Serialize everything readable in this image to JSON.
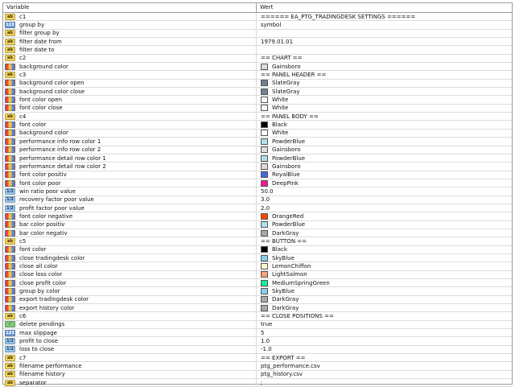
{
  "header": {
    "variable": "Variable",
    "value": "Wert"
  },
  "rows": [
    {
      "icon": "str",
      "name": "c1",
      "value": "====== EA_PTG_TRADINGDESK SETTINGS ======"
    },
    {
      "icon": "int",
      "name": "group by",
      "value": "symbol"
    },
    {
      "icon": "str",
      "name": "filter group by",
      "value": ""
    },
    {
      "icon": "str",
      "name": "filter date from",
      "value": "1979.01.01"
    },
    {
      "icon": "str",
      "name": "filter date to",
      "value": ""
    },
    {
      "icon": "str",
      "name": "c2",
      "value": "== CHART =="
    },
    {
      "icon": "color",
      "name": "background color",
      "value": "Gainsboro",
      "swatch": "#dcdcdc"
    },
    {
      "icon": "str",
      "name": "c3",
      "value": "== PANEL HEADER =="
    },
    {
      "icon": "color",
      "name": "background color open",
      "value": "SlateGray",
      "swatch": "#708090"
    },
    {
      "icon": "color",
      "name": "background color close",
      "value": "SlateGray",
      "swatch": "#708090"
    },
    {
      "icon": "color",
      "name": "font color open",
      "value": "White",
      "swatch": "#ffffff"
    },
    {
      "icon": "color",
      "name": "font color close",
      "value": "White",
      "swatch": "#ffffff"
    },
    {
      "icon": "str",
      "name": "c4",
      "value": "== PANEL BODY =="
    },
    {
      "icon": "color",
      "name": "font color",
      "value": "Black",
      "swatch": "#000000"
    },
    {
      "icon": "color",
      "name": "background color",
      "value": "White",
      "swatch": "#ffffff"
    },
    {
      "icon": "color",
      "name": "performance info row color 1",
      "value": "PowderBlue",
      "swatch": "#b0e0e6"
    },
    {
      "icon": "color",
      "name": "performance info row color 2",
      "value": "Gainsboro",
      "swatch": "#dcdcdc"
    },
    {
      "icon": "color",
      "name": "performance detail row color 1",
      "value": "PowderBlue",
      "swatch": "#b0e0e6"
    },
    {
      "icon": "color",
      "name": "performance detail row color 2",
      "value": "Gainsboro",
      "swatch": "#dcdcdc"
    },
    {
      "icon": "color",
      "name": "font color positiv",
      "value": "RoyalBlue",
      "swatch": "#4169e1"
    },
    {
      "icon": "color",
      "name": "font color poor",
      "value": "DeepPink",
      "swatch": "#ff1493"
    },
    {
      "icon": "dbl",
      "name": "win ratio poor value",
      "value": "50.0"
    },
    {
      "icon": "dbl",
      "name": "recovery factor poor value",
      "value": "3.0"
    },
    {
      "icon": "dbl",
      "name": "profit factor poor value",
      "value": "2.0"
    },
    {
      "icon": "color",
      "name": "font color negative",
      "value": "OrangeRed",
      "swatch": "#ff4500"
    },
    {
      "icon": "color",
      "name": "bar color positiv",
      "value": "PowderBlue",
      "swatch": "#b0e0e6"
    },
    {
      "icon": "color",
      "name": "bar color negativ",
      "value": "DarkGray",
      "swatch": "#a9a9a9"
    },
    {
      "icon": "str",
      "name": "c5",
      "value": "== BUTTON =="
    },
    {
      "icon": "color",
      "name": "font color",
      "value": "Black",
      "swatch": "#000000"
    },
    {
      "icon": "color",
      "name": "close tradingdesk color",
      "value": "SkyBlue",
      "swatch": "#87ceeb"
    },
    {
      "icon": "color",
      "name": "close all color",
      "value": "LemonChiffon",
      "swatch": "#fffacd"
    },
    {
      "icon": "color",
      "name": "close loss color",
      "value": "LightSalmon",
      "swatch": "#ffa07a"
    },
    {
      "icon": "color",
      "name": "close profit color",
      "value": "MediumSpringGreen",
      "swatch": "#00fa9a"
    },
    {
      "icon": "color",
      "name": "group by color",
      "value": "SkyBlue",
      "swatch": "#87ceeb"
    },
    {
      "icon": "color",
      "name": "export tradingdesk color",
      "value": "DarkGray",
      "swatch": "#a9a9a9"
    },
    {
      "icon": "color",
      "name": "export history color",
      "value": "DarkGray",
      "swatch": "#a9a9a9"
    },
    {
      "icon": "str",
      "name": "c6",
      "value": "== CLOSE POSITIONS =="
    },
    {
      "icon": "bool",
      "name": "delete pendings",
      "value": "true"
    },
    {
      "icon": "int",
      "name": "max slippage",
      "value": "5"
    },
    {
      "icon": "dbl",
      "name": "profit to close",
      "value": "1.0"
    },
    {
      "icon": "dbl",
      "name": "loss to close",
      "value": "-1.0"
    },
    {
      "icon": "str",
      "name": "c7",
      "value": "== EXPORT =="
    },
    {
      "icon": "str",
      "name": "filename performance",
      "value": "ptg_performance.csv"
    },
    {
      "icon": "str",
      "name": "filename history",
      "value": "ptg_history.csv"
    },
    {
      "icon": "str",
      "name": "separator",
      "value": ";"
    }
  ],
  "icon_labels": {
    "str": "ab",
    "int": "123",
    "dbl": "1/2",
    "bool": "✓",
    "color": ""
  }
}
